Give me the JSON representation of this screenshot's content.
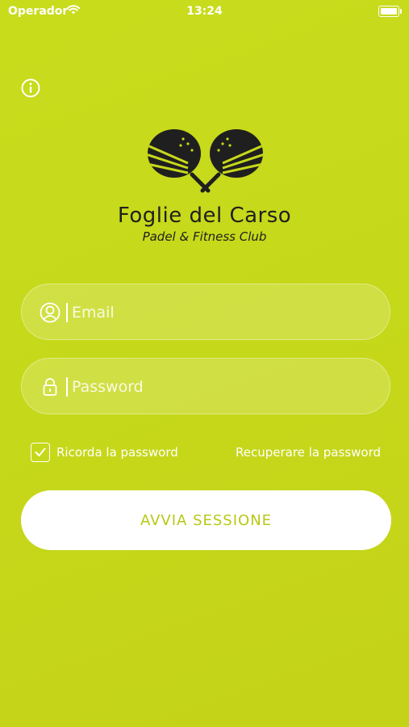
{
  "status_bar": {
    "carrier": "Operador",
    "time": "13:24"
  },
  "brand": {
    "title": "Foglie del Carso",
    "subtitle": "Padel & Fitness Club"
  },
  "form": {
    "email_placeholder": "Email",
    "password_placeholder": "Password",
    "remember_label": "Ricorda la password",
    "remember_checked": true,
    "recover_label": "Recuperare la password",
    "submit_label": "AVVIA SESSIONE"
  },
  "colors": {
    "background": "#c6d81a",
    "button_text": "#b8c815",
    "logo": "#1f1f1f"
  },
  "icons": [
    "wifi-icon",
    "battery-icon",
    "info-icon",
    "user-icon",
    "lock-icon",
    "check-icon"
  ]
}
